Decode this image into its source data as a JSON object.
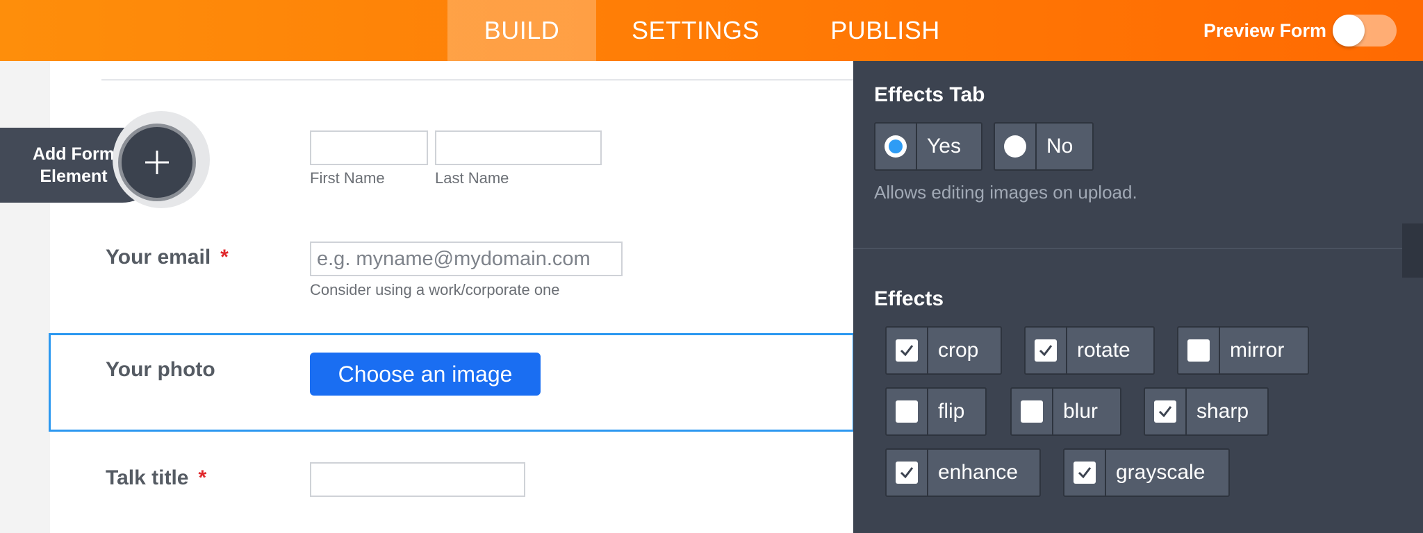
{
  "topbar": {
    "tabs": [
      {
        "label": "BUILD",
        "active": true
      },
      {
        "label": "SETTINGS",
        "active": false
      },
      {
        "label": "PUBLISH",
        "active": false
      }
    ],
    "preview_label": "Preview Form",
    "preview_enabled": false
  },
  "form": {
    "add_element_label_line1": "Add Form",
    "add_element_label_line2": "Element",
    "first_name_label": "First Name",
    "last_name_label": "Last Name",
    "email_label": "Your email",
    "email_required_mark": "*",
    "email_placeholder": "e.g. myname@mydomain.com",
    "email_hint": "Consider using a work/corporate one",
    "photo_label": "Your photo",
    "photo_button_label": "Choose an image",
    "talk_title_label": "Talk title",
    "talk_title_required_mark": "*"
  },
  "panel": {
    "effects_tab_title": "Effects Tab",
    "effects_tab_options": [
      {
        "label": "Yes",
        "selected": true
      },
      {
        "label": "No",
        "selected": false
      }
    ],
    "effects_tab_help": "Allows editing images on upload.",
    "effects_title": "Effects",
    "effects": [
      {
        "label": "crop",
        "checked": true
      },
      {
        "label": "rotate",
        "checked": true
      },
      {
        "label": "mirror",
        "checked": false
      },
      {
        "label": "flip",
        "checked": false
      },
      {
        "label": "blur",
        "checked": false
      },
      {
        "label": "sharp",
        "checked": true
      },
      {
        "label": "enhance",
        "checked": true
      },
      {
        "label": "grayscale",
        "checked": true
      }
    ]
  },
  "colors": {
    "topbar_orange": "#ff7a05",
    "panel_bg": "#3c4350",
    "accent_blue": "#1a6ef2",
    "selection_border": "#2c98f0",
    "required_red": "#e0272b"
  }
}
